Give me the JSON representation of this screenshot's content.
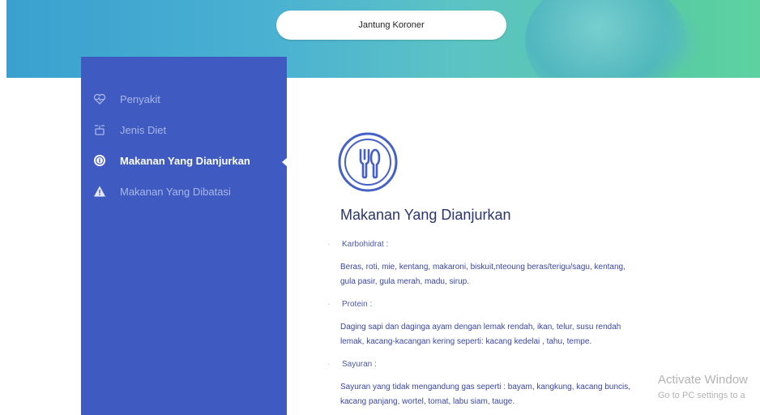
{
  "header": {
    "search_text": "Jantung Koroner"
  },
  "sidebar": {
    "items": [
      {
        "label": "Penyakit",
        "icon": "heart-pulse-icon",
        "active": false
      },
      {
        "label": "Jenis Diet",
        "icon": "scale-icon",
        "active": false
      },
      {
        "label": "Makanan Yang Dianjurkan",
        "icon": "info-circle-icon",
        "active": true
      },
      {
        "label": "Makanan Yang Dibatasi",
        "icon": "warning-icon",
        "active": false
      }
    ]
  },
  "main": {
    "icon": "fork-spoon-icon",
    "title": "Makanan Yang Dianjurkan",
    "sections": [
      {
        "label": "Karbohidrat :",
        "text_line1": "Beras, roti, mie, kentang, makaroni, biskuit,nteoung beras/terigu/sagu, kentang,",
        "text_line2": "gula pasir, gula merah, madu, sirup."
      },
      {
        "label": "Protein :",
        "text_line1": "Daging sapi dan daginga ayam dengan lemak rendah, ikan, telur, susu rendah",
        "text_line2": "lemak, kacang-kacangan kering seperti: kacang kedelai , tahu, tempe."
      },
      {
        "label": "Sayuran :",
        "text_line1": "Sayuran yang tidak mengandung gas seperti : bayam, kangkung, kacang buncis,",
        "text_line2": "kacang panjang, wortel, tomat, labu siam, tauge."
      }
    ]
  },
  "watermark": {
    "title": "Activate Window",
    "subtitle": "Go to PC settings to a"
  },
  "colors": {
    "sidebar": "#3f5bc1",
    "accent": "#3f5bc1",
    "banner_start": "#3aa0cf",
    "banner_end": "#5dd2a0"
  }
}
